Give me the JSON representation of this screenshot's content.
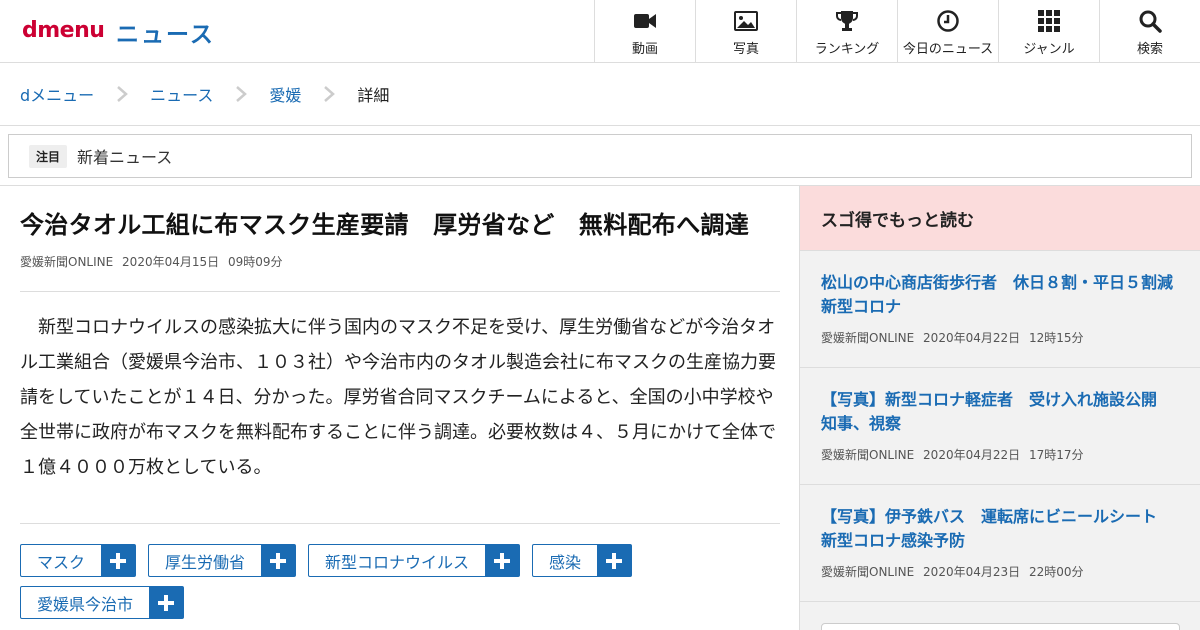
{
  "header": {
    "logo": "dmenu",
    "section": "ニュース",
    "nav": [
      {
        "label": "動画",
        "icon": "video-camera-icon"
      },
      {
        "label": "写真",
        "icon": "photo-icon"
      },
      {
        "label": "ランキング",
        "icon": "trophy-icon"
      },
      {
        "label": "今日のニュース",
        "icon": "clock-icon"
      },
      {
        "label": "ジャンル",
        "icon": "grid-icon"
      },
      {
        "label": "検索",
        "icon": "search-icon"
      }
    ]
  },
  "breadcrumb": {
    "items": [
      "dメニュー",
      "ニュース",
      "愛媛",
      "詳細"
    ]
  },
  "notice": {
    "badge": "注目",
    "text": "新着ニュース"
  },
  "article": {
    "title": "今治タオル工組に布マスク生産要請　厚労省など　無料配布へ調達",
    "source": "愛媛新聞ONLINE",
    "date": "2020年04月15日",
    "time": "09時09分",
    "body": "新型コロナウイルスの感染拡大に伴う国内のマスク不足を受け、厚生労働省などが今治タオル工業組合（愛媛県今治市、１０３社）や今治市内のタオル製造会社に布マスクの生産協力要請をしていたことが１４日、分かった。厚労省合同マスクチームによると、全国の小中学校や全世帯に政府が布マスクを無料配布することに伴う調達。必要枚数は４、５月にかけて全体で１億４０００万枚としている。",
    "tags": [
      "マスク",
      "厚生労働省",
      "新型コロナウイルス",
      "感染",
      "愛媛県今治市"
    ]
  },
  "sidebar": {
    "header": "スゴ得でもっと読む",
    "items": [
      {
        "title": "松山の中心商店街歩行者　休日８割・平日５割減　新型コロナ",
        "source": "愛媛新聞ONLINE",
        "date": "2020年04月22日",
        "time": "12時15分"
      },
      {
        "title": "【写真】新型コロナ軽症者　受け入れ施設公開　知事、視察",
        "source": "愛媛新聞ONLINE",
        "date": "2020年04月22日",
        "time": "17時17分"
      },
      {
        "title": "【写真】伊予鉄バス　運転席にビニールシート　新型コロナ感染予防",
        "source": "愛媛新聞ONLINE",
        "date": "2020年04月23日",
        "time": "22時00分"
      }
    ]
  },
  "colors": {
    "accent": "#1a6bb3",
    "brand": "#cc0033",
    "sidebar_header_bg": "#fbdcdc"
  }
}
